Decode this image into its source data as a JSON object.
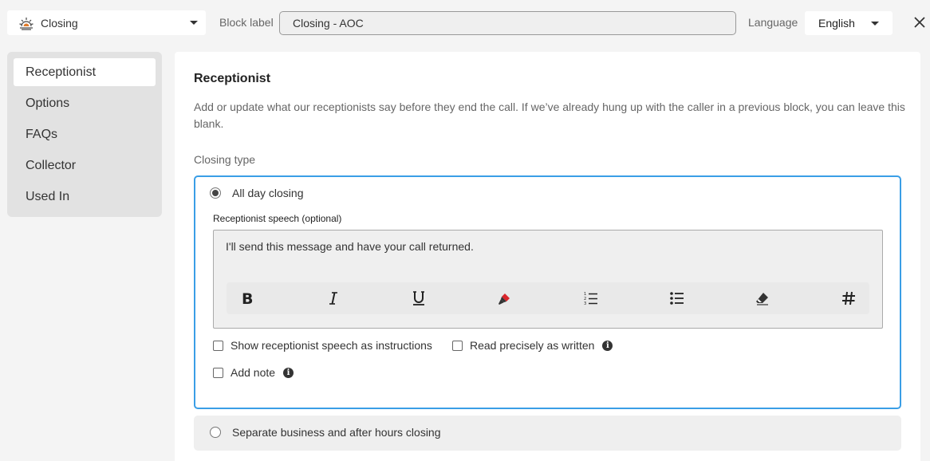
{
  "header": {
    "block_type": "Closing",
    "block_label_caption": "Block label",
    "block_label_value": "Closing - AOC",
    "language_caption": "Language",
    "language_value": "English",
    "block_icon": "sunset-icon"
  },
  "sidebar": {
    "items": [
      {
        "label": "Receptionist",
        "active": true
      },
      {
        "label": "Options"
      },
      {
        "label": "FAQs"
      },
      {
        "label": "Collector"
      },
      {
        "label": "Used In"
      }
    ]
  },
  "main": {
    "title": "Receptionist",
    "description": "Add or update what our receptionists say before they end the call. If we’ve already hung up with the caller in a previous block, you can leave this blank.",
    "closing_type_label": "Closing type",
    "option_all_day": {
      "label": "All day closing",
      "selected": true,
      "speech_label": "Receptionist speech (optional)",
      "speech_text": "I'll send this message and have your call returned.",
      "toolbar": [
        "bold-icon",
        "italic-icon",
        "underline-icon",
        "highlight-icon",
        "numbered-list-icon",
        "bullet-list-icon",
        "eraser-icon",
        "hashtag-icon"
      ],
      "checkboxes": {
        "show_as_instructions": "Show receptionist speech as instructions",
        "read_precisely": "Read precisely as written",
        "add_note": "Add note"
      }
    },
    "option_separate": {
      "label": "Separate business and after hours closing",
      "selected": false
    }
  },
  "colors": {
    "accent_border": "#3a9ee6",
    "highlight_marker": "#d9262c"
  }
}
